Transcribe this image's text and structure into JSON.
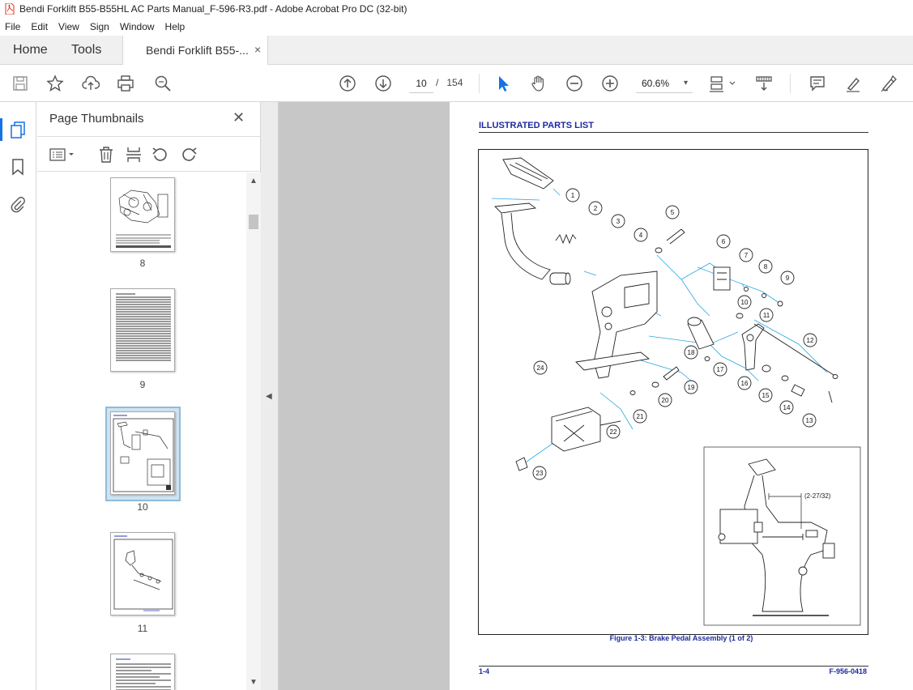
{
  "window": {
    "title": "Bendi Forklift B55-B55HL AC Parts Manual_F-596-R3.pdf - Adobe Acrobat Pro DC (32-bit)"
  },
  "menu": [
    "File",
    "Edit",
    "View",
    "Sign",
    "Window",
    "Help"
  ],
  "tabs": {
    "home": "Home",
    "tools": "Tools",
    "document": "Bendi Forklift B55-...",
    "close": "×"
  },
  "toolbar": {
    "current_page": "10",
    "page_separator": "/",
    "total_pages": "154",
    "zoom": "60.6%",
    "zoom_arrow": "▾"
  },
  "panel": {
    "title": "Page Thumbnails",
    "close": "✕",
    "thumbnails": [
      {
        "label": "8"
      },
      {
        "label": "9"
      },
      {
        "label": "10",
        "selected": true
      },
      {
        "label": "11"
      }
    ]
  },
  "document": {
    "header": "ILLUSTRATED PARTS LIST",
    "caption": "Figure 1-3:  Brake Pedal Assembly (1 of 2)",
    "footer_left": "1-4",
    "footer_right": "F-956-0418",
    "inset_dimension": "(2-27/32)",
    "callouts": [
      "1",
      "2",
      "3",
      "4",
      "5",
      "6",
      "7",
      "8",
      "9",
      "10",
      "11",
      "12",
      "13",
      "14",
      "15",
      "16",
      "17",
      "18",
      "19",
      "20",
      "21",
      "22",
      "23",
      "24"
    ]
  },
  "colors": {
    "accent": "#1473e6",
    "doc_heading": "#1e2aa0",
    "callout_lines": "#29a8e0"
  }
}
